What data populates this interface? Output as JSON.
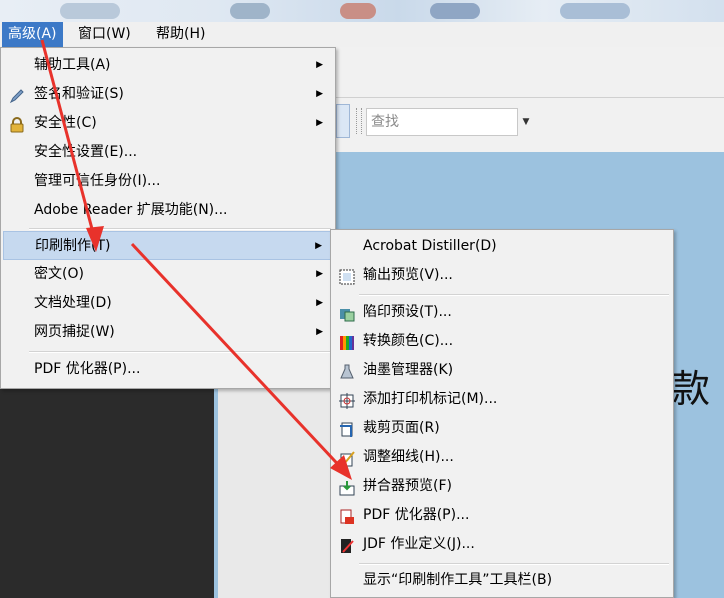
{
  "menubar": {
    "items": [
      {
        "label": "高级(A)",
        "active": true
      },
      {
        "label": "窗口(W)",
        "active": false
      },
      {
        "label": "帮助(H)",
        "active": false
      }
    ]
  },
  "toolbar": {
    "find_placeholder": "查找"
  },
  "document": {
    "visible_char": "款"
  },
  "advanced_menu": {
    "items": [
      {
        "label": "辅助工具(A)",
        "icon": "",
        "submenu": true
      },
      {
        "label": "签名和验证(S)",
        "icon": "pen-icon",
        "submenu": true
      },
      {
        "label": "安全性(C)",
        "icon": "lock-icon",
        "submenu": true
      },
      {
        "label": "安全性设置(E)...",
        "icon": "",
        "submenu": false
      },
      {
        "label": "管理可信任身份(I)...",
        "icon": "",
        "submenu": false
      },
      {
        "label": "Adobe Reader 扩展功能(N)...",
        "icon": "",
        "submenu": false
      },
      {
        "label": "印刷制作(T)",
        "icon": "",
        "submenu": true,
        "highlighted": true
      },
      {
        "label": "密文(O)",
        "icon": "",
        "submenu": true
      },
      {
        "label": "文档处理(D)",
        "icon": "",
        "submenu": true
      },
      {
        "label": "网页捕捉(W)",
        "icon": "",
        "submenu": true
      },
      {
        "label": "PDF 优化器(P)...",
        "icon": "",
        "submenu": false
      }
    ]
  },
  "print_production_menu": {
    "items": [
      {
        "label": "Acrobat Distiller(D)",
        "icon": ""
      },
      {
        "label": "输出预览(V)...",
        "icon": "output-preview-icon"
      },
      {
        "label": "陷印预设(T)...",
        "icon": "trap-presets-icon"
      },
      {
        "label": "转换颜色(C)...",
        "icon": "convert-colors-icon"
      },
      {
        "label": "油墨管理器(K)",
        "icon": "ink-manager-icon"
      },
      {
        "label": "添加打印机标记(M)...",
        "icon": "printer-marks-icon"
      },
      {
        "label": "裁剪页面(R)",
        "icon": "crop-pages-icon"
      },
      {
        "label": "调整细线(H)...",
        "icon": "fix-hairlines-icon"
      },
      {
        "label": "拼合器预览(F)",
        "icon": "flattener-preview-icon"
      },
      {
        "label": "PDF 优化器(P)...",
        "icon": "pdf-optimizer-icon"
      },
      {
        "label": "JDF 作业定义(J)...",
        "icon": "jdf-icon"
      },
      {
        "label": "显示“印刷制作工具”工具栏(B)",
        "icon": ""
      }
    ]
  },
  "colors": {
    "menubar_active": "#3c79c7",
    "menu_highlight": "#c6d9ef",
    "annotation_arrow": "#e8322b",
    "document_bg": "#9cc2df"
  }
}
